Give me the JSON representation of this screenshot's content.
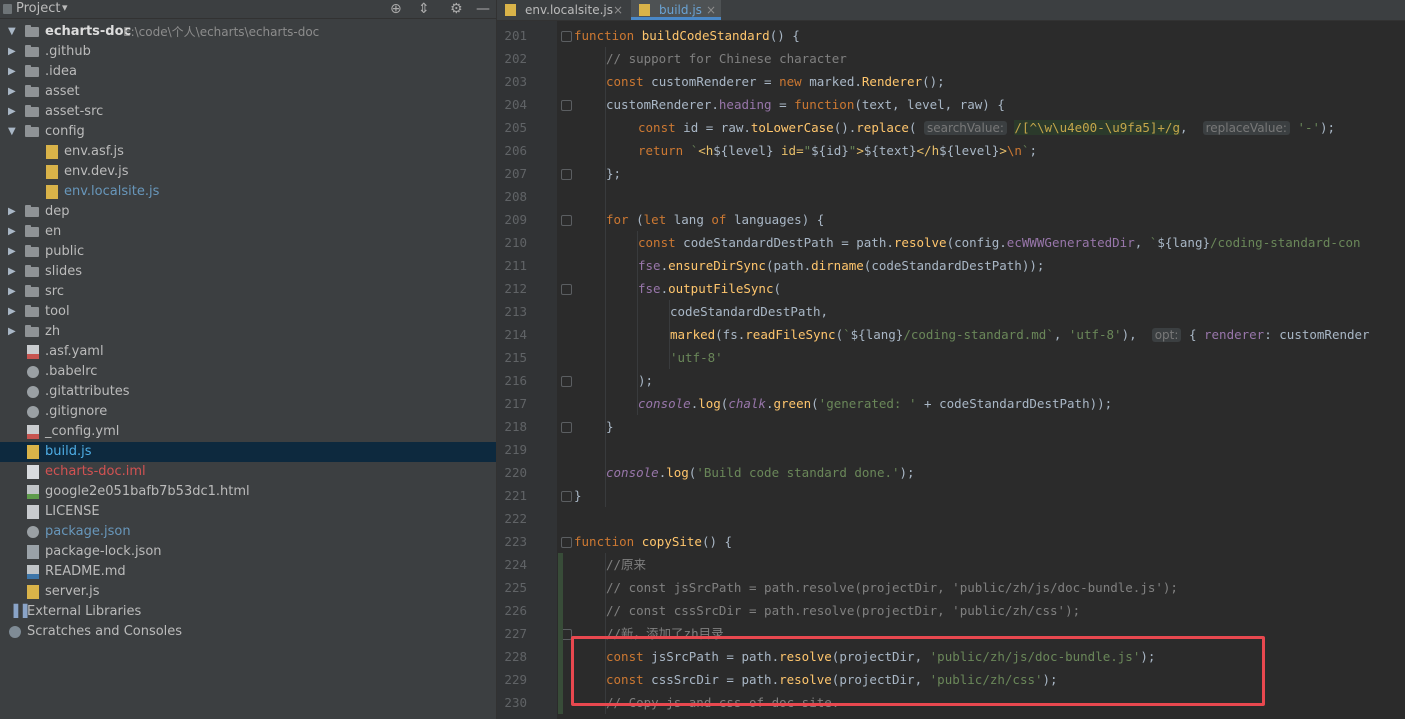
{
  "project_panel": {
    "title": "Project",
    "title_caret": "▾",
    "header_icons": [
      {
        "name": "locate-icon",
        "glyph": "⊕"
      },
      {
        "name": "collapse-icon",
        "glyph": "⇕"
      },
      {
        "name": "settings-icon",
        "glyph": "⚙"
      },
      {
        "name": "hide-icon",
        "glyph": "—"
      }
    ],
    "tree": [
      {
        "label": "echarts-doc",
        "path": "E:\\code\\个人\\echarts\\echarts-doc",
        "type": "root",
        "depth": 0,
        "expanded": true
      },
      {
        "label": ".github",
        "type": "folder",
        "depth": 1
      },
      {
        "label": ".idea",
        "type": "folder",
        "depth": 1
      },
      {
        "label": "asset",
        "type": "folder",
        "depth": 1
      },
      {
        "label": "asset-src",
        "type": "folder",
        "depth": 1
      },
      {
        "label": "config",
        "type": "folder",
        "depth": 1,
        "expanded": true
      },
      {
        "label": "env.asf.js",
        "type": "js",
        "depth": 2
      },
      {
        "label": "env.dev.js",
        "type": "js",
        "depth": 2
      },
      {
        "label": "env.localsite.js",
        "type": "js",
        "depth": 2,
        "color": "blue"
      },
      {
        "label": "dep",
        "type": "folder",
        "depth": 1
      },
      {
        "label": "en",
        "type": "folder",
        "depth": 1
      },
      {
        "label": "public",
        "type": "folder",
        "depth": 1
      },
      {
        "label": "slides",
        "type": "folder",
        "depth": 1
      },
      {
        "label": "src",
        "type": "folder",
        "depth": 1
      },
      {
        "label": "tool",
        "type": "folder",
        "depth": 1
      },
      {
        "label": "zh",
        "type": "folder",
        "depth": 1
      },
      {
        "label": ".asf.yaml",
        "type": "yml",
        "depth": 1
      },
      {
        "label": ".babelrc",
        "type": "gear",
        "depth": 1
      },
      {
        "label": ".gitattributes",
        "type": "gear",
        "depth": 1
      },
      {
        "label": ".gitignore",
        "type": "gear",
        "depth": 1
      },
      {
        "label": "_config.yml",
        "type": "yml",
        "depth": 1
      },
      {
        "label": "build.js",
        "type": "js",
        "depth": 1,
        "selected": true,
        "color": "teal"
      },
      {
        "label": "echarts-doc.iml",
        "type": "iml",
        "depth": 1,
        "color": "red"
      },
      {
        "label": "google2e051bafb7b53dc1.html",
        "type": "html",
        "depth": 1
      },
      {
        "label": "LICENSE",
        "type": "txt",
        "depth": 1
      },
      {
        "label": "package.json",
        "type": "gear",
        "depth": 1,
        "color": "blue"
      },
      {
        "label": "package-lock.json",
        "type": "json",
        "depth": 1
      },
      {
        "label": "README.md",
        "type": "md",
        "depth": 1
      },
      {
        "label": "server.js",
        "type": "js",
        "depth": 1
      },
      {
        "label": "External Libraries",
        "type": "lib",
        "depth": 0
      },
      {
        "label": "Scratches and Consoles",
        "type": "scratch",
        "depth": 0
      }
    ]
  },
  "editor": {
    "tabs": [
      {
        "label": "env.localsite.js",
        "active": false,
        "close": "×"
      },
      {
        "label": "build.js",
        "active": true,
        "close": "×"
      }
    ],
    "line_numbers": [
      "201",
      "202",
      "203",
      "204",
      "205",
      "206",
      "207",
      "208",
      "209",
      "210",
      "211",
      "212",
      "213",
      "214",
      "215",
      "216",
      "217",
      "218",
      "219",
      "220",
      "221",
      "222",
      "223",
      "224",
      "225",
      "226",
      "227",
      "228",
      "229",
      "230"
    ],
    "code_lines": [
      {
        "indent": 0,
        "html": "<span class='k'>function</span> <span class='fn'>buildCodeStandard</span>() {"
      },
      {
        "indent": 1,
        "html": "<span class='cm'>// support for Chinese character</span>"
      },
      {
        "indent": 1,
        "html": "<span class='k'>const</span> customRenderer = <span class='k'>new</span> marked.<span class='fn'>Renderer</span>();"
      },
      {
        "indent": 1,
        "html": "customRenderer.<span class='pr'>heading</span> = <span class='k'>function</span>(text, level, raw) {"
      },
      {
        "indent": 2,
        "html": "<span class='k'>const</span> id = raw.<span class='fn'>toLowerCase</span>().<span class='fn'>replace</span>( <span class='hint'>searchValue:</span> <span class='rx'>/[^\\w\\u4e00-\\u9fa5]+/g</span>,  <span class='hint'>replaceValue:</span> <span class='s'>'-'</span>);"
      },
      {
        "indent": 2,
        "html": "<span class='k'>return</span> <span class='s'>`</span><span class='tag'>&lt;h</span>${level}<span class='tag'> id=</span><span class='s'>\"</span>${id}<span class='s'>\"</span><span class='tag'>&gt;</span>${text}<span class='tag'>&lt;/h</span>${level}<span class='tag'>&gt;</span><span class='k'>\\n</span><span class='s'>`</span>;"
      },
      {
        "indent": 1,
        "html": "};"
      },
      {
        "indent": 0,
        "html": ""
      },
      {
        "indent": 1,
        "html": "<span class='k'>for</span> (<span class='k'>let</span> lang <span class='k'>of</span> languages) {"
      },
      {
        "indent": 2,
        "html": "<span class='k'>const</span> codeStandardDestPath = path.<span class='fn'>resolve</span>(config.<span class='pr'>ecWWWGeneratedDir</span>, <span class='s'>`</span>${lang}<span class='s'>/coding-standard-con</span>"
      },
      {
        "indent": 2,
        "html": "<span class='pr'>fse</span>.<span class='fn'>ensureDirSync</span>(path.<span class='fn'>dirname</span>(codeStandardDestPath));"
      },
      {
        "indent": 2,
        "html": "<span class='pr'>fse</span>.<span class='fn'>outputFileSync</span>("
      },
      {
        "indent": 3,
        "html": "codeStandardDestPath,"
      },
      {
        "indent": 3,
        "html": "<span class='fn'>marked</span>(fs.<span class='fn'>readFileSync</span>(<span class='s'>`</span>${lang}<span class='s'>/coding-standard.md`</span>, <span class='s'>'utf-8'</span>),  <span class='hint'>opt:</span> { <span class='pr'>renderer</span>: customRender"
      },
      {
        "indent": 3,
        "html": "<span class='s'>'utf-8'</span>"
      },
      {
        "indent": 2,
        "html": ");"
      },
      {
        "indent": 2,
        "html": "<span class='it'>console</span>.<span class='fn'>log</span>(<span class='it'>chalk</span>.<span class='fn'>green</span>(<span class='s'>'generated: '</span> + codeStandardDestPath));"
      },
      {
        "indent": 1,
        "html": "}"
      },
      {
        "indent": 0,
        "html": ""
      },
      {
        "indent": 1,
        "html": "<span class='it'>console</span>.<span class='fn'>log</span>(<span class='s'>'Build code standard done.'</span>);"
      },
      {
        "indent": 0,
        "html": "}"
      },
      {
        "indent": 0,
        "html": ""
      },
      {
        "indent": 0,
        "html": "<span class='k'>function</span> <span class='fn'>copySite</span>() {"
      },
      {
        "indent": 1,
        "html": "<span class='cm'>//原来</span>"
      },
      {
        "indent": 1,
        "html": "<span class='cm'>// const jsSrcPath = path.resolve(projectDir, 'public/zh/js/doc-bundle.js');</span>"
      },
      {
        "indent": 1,
        "html": "<span class='cm'>// const cssSrcDir = path.resolve(projectDir, 'public/zh/css');</span>"
      },
      {
        "indent": 1,
        "html": "<span class='cm'>//新，添加了zh目录</span>"
      },
      {
        "indent": 1,
        "html": "<span class='k'>const</span> jsSrcPath = path.<span class='fn'>resolve</span>(projectDir, <span class='s'>'public/zh/js/doc-bundle.js'</span>);"
      },
      {
        "indent": 1,
        "html": "<span class='k'>const</span> cssSrcDir = path.<span class='fn'>resolve</span>(projectDir, <span class='s'>'public/zh/css'</span>);"
      },
      {
        "indent": 1,
        "html": "<span class='cm'>// Copy js and css of doc site.</span>"
      }
    ],
    "fold_markers_at_lines": [
      201,
      204,
      207,
      209,
      212,
      216,
      218,
      221,
      223,
      227
    ]
  },
  "colors": {
    "highlight_box": "#e8484f",
    "editor_bg": "#2b2b2b",
    "panel_bg": "#3c3f41",
    "selection_bg": "#0d293e"
  }
}
